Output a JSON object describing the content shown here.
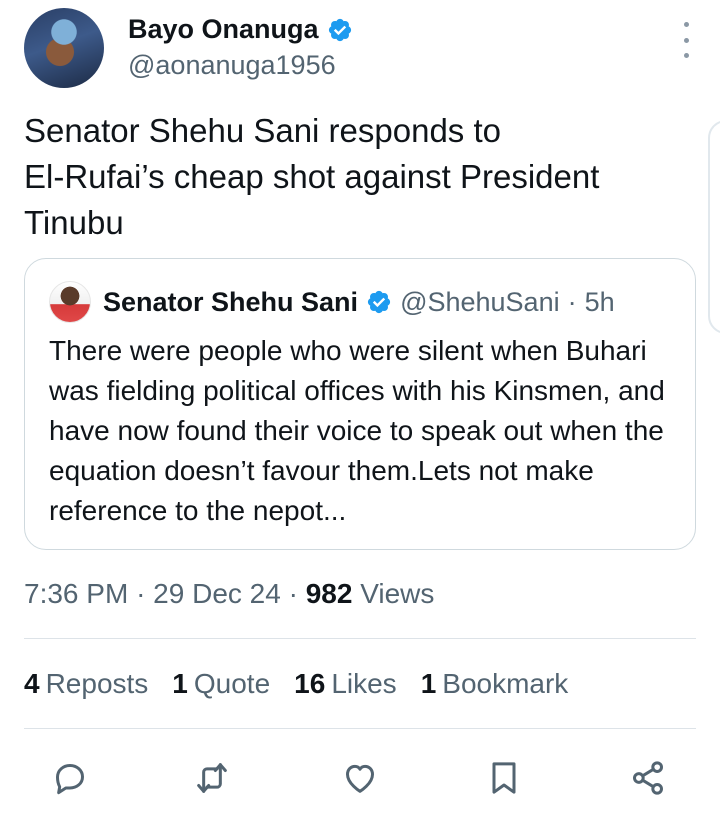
{
  "author": {
    "name": "Bayo Onanuga",
    "handle": "@aonanuga1956",
    "verified_color": "#1d9bf0"
  },
  "tweet": {
    "text": "Senator Shehu Sani responds to\nEl-Rufai’s  cheap shot against President\nTinubu"
  },
  "quoted": {
    "name": "Senator Shehu Sani",
    "handle": "@ShehuSani",
    "separator": "·",
    "age": "5h",
    "text": "There were people who were silent when Buhari was fielding political offices with his Kinsmen, and have now found their voice to speak out when the equation doesn’t favour them.Lets not make reference to the nepot..."
  },
  "meta": {
    "time": "7:36 PM",
    "date": "29 Dec 24",
    "views_count": "982",
    "views_label": "Views",
    "separator": "·"
  },
  "stats": [
    {
      "count": "4",
      "label": "Reposts"
    },
    {
      "count": "1",
      "label": "Quote"
    },
    {
      "count": "16",
      "label": "Likes"
    },
    {
      "count": "1",
      "label": "Bookmark"
    }
  ],
  "actions": [
    "reply-icon",
    "repost-icon",
    "like-icon",
    "bookmark-icon",
    "share-icon"
  ],
  "colors": {
    "text": "#0f1419",
    "secondary": "#536471",
    "icon": "#536471",
    "border": "#cfd9de"
  }
}
